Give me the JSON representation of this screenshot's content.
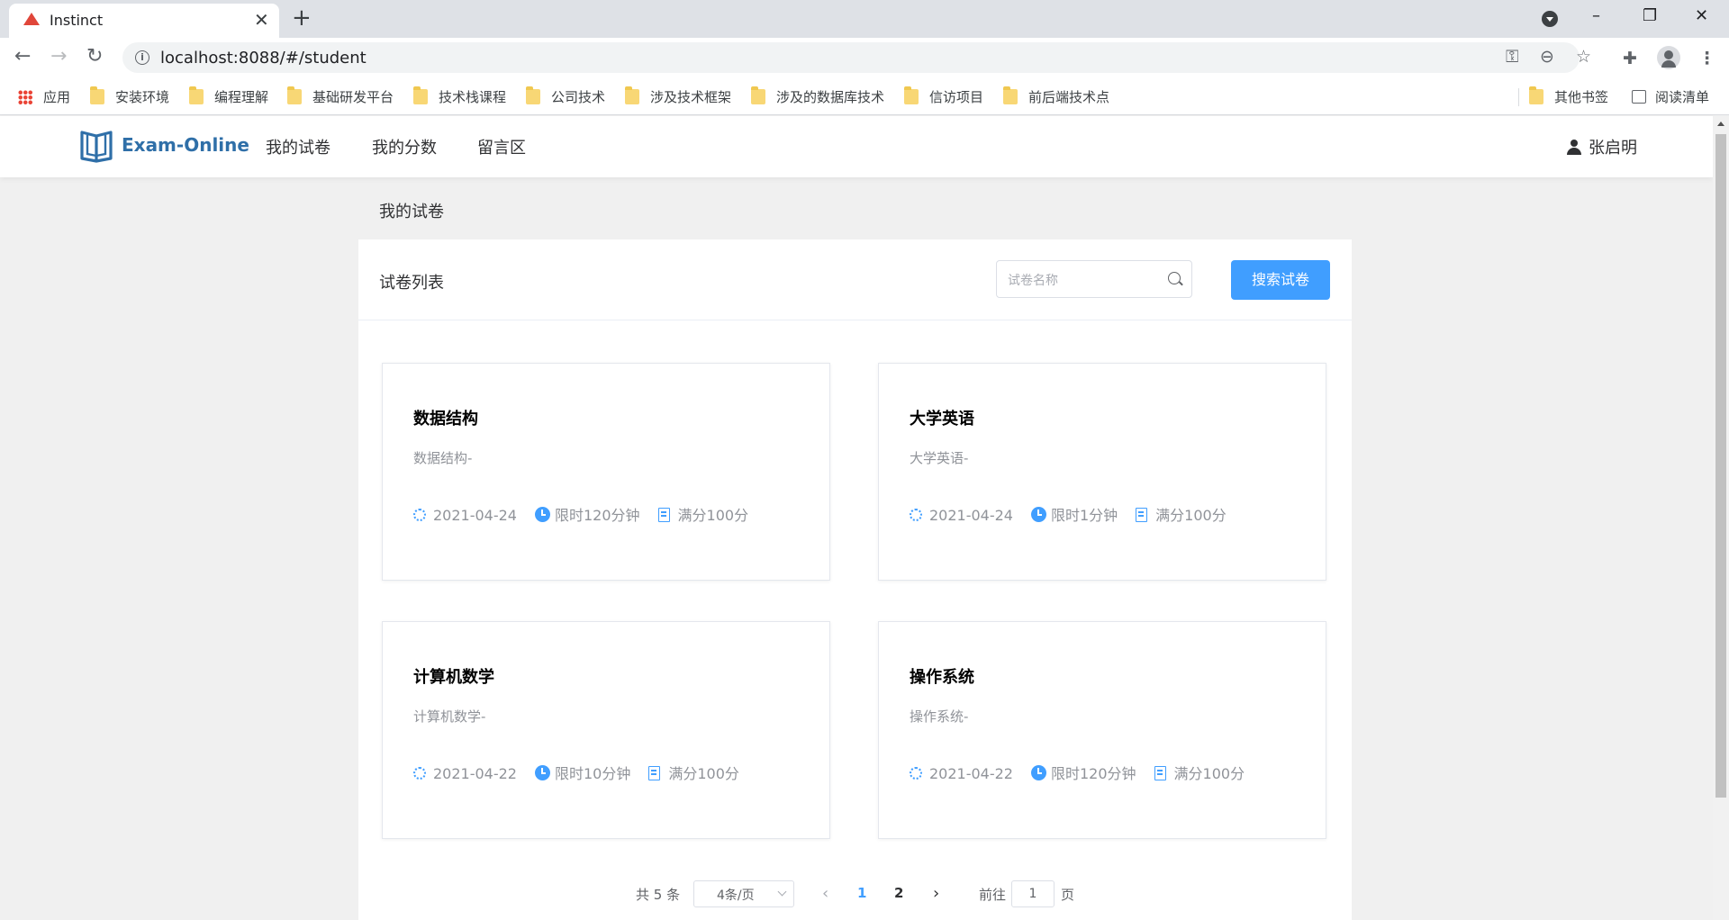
{
  "browser": {
    "tab_title": "Instinct",
    "url": "localhost:8088/#/student",
    "bookmarks": [
      {
        "label": "应用"
      },
      {
        "label": "安装环境"
      },
      {
        "label": "编程理解"
      },
      {
        "label": "基础研发平台"
      },
      {
        "label": "技术栈课程"
      },
      {
        "label": "公司技术"
      },
      {
        "label": "涉及技术框架"
      },
      {
        "label": "涉及的数据库技术"
      },
      {
        "label": "信访项目"
      },
      {
        "label": "前后端技术点"
      }
    ],
    "other_bookmarks": "其他书签",
    "reading_list": "阅读清单"
  },
  "header": {
    "logo_text": "Exam-Online",
    "nav": [
      "我的试卷",
      "我的分数",
      "留言区"
    ],
    "user_name": "张启明"
  },
  "main": {
    "section_title": "我的试卷",
    "panel_title": "试卷列表",
    "search_placeholder": "试卷名称",
    "search_button": "搜索试卷",
    "cards": [
      {
        "title": "数据结构",
        "desc": "数据结构-",
        "date": "2021-04-24",
        "limit": "限时120分钟",
        "score": "满分100分"
      },
      {
        "title": "大学英语",
        "desc": "大学英语-",
        "date": "2021-04-24",
        "limit": "限时1分钟",
        "score": "满分100分"
      },
      {
        "title": "计算机数学",
        "desc": "计算机数学-",
        "date": "2021-04-22",
        "limit": "限时10分钟",
        "score": "满分100分"
      },
      {
        "title": "操作系统",
        "desc": "操作系统-",
        "date": "2021-04-22",
        "limit": "限时120分钟",
        "score": "满分100分"
      }
    ],
    "pagination": {
      "total": "共 5 条",
      "page_size": "4条/页",
      "pages": [
        "1",
        "2"
      ],
      "current_page": "1",
      "goto_label": "前往",
      "goto_value": "1",
      "goto_unit": "页"
    }
  },
  "colors": {
    "accent": "#409eff",
    "logo": "#2f6fa8"
  }
}
